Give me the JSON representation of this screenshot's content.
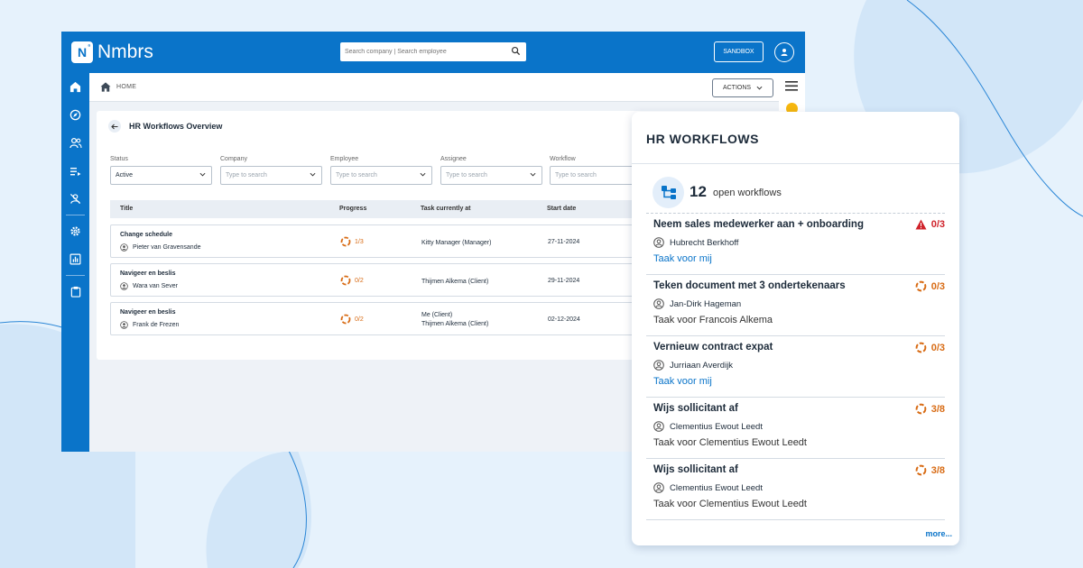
{
  "app": {
    "logo_mark": "N",
    "logo_sup": "ª",
    "name": "Nmbrs"
  },
  "topbar": {
    "search_placeholder": "Search company | Search employee",
    "sandbox_label": "SANDBOX"
  },
  "subbar": {
    "breadcrumb": "HOME",
    "actions_label": "ACTIONS"
  },
  "card": {
    "title": "HR Workflows Overview"
  },
  "filters": [
    {
      "label": "Status",
      "value": "Active"
    },
    {
      "label": "Company",
      "value": "Type to search"
    },
    {
      "label": "Employee",
      "value": "Type to search"
    },
    {
      "label": "Assignee",
      "value": "Type to search"
    },
    {
      "label": "Workflow",
      "value": "Type to search"
    }
  ],
  "table": {
    "headers": [
      "Title",
      "Progress",
      "Task currently at",
      "Start date"
    ],
    "rows": [
      {
        "title": "Change schedule",
        "person": "Pieter van Gravensande",
        "progress": "1/3",
        "task1": "Kitty Manager (Manager)",
        "task2": "",
        "date": "27-11-2024"
      },
      {
        "title": "Navigeer en beslis",
        "person": "Wara van Sever",
        "progress": "0/2",
        "task1": "Thijmen Alkema (Client)",
        "task2": "",
        "date": "29-11-2024"
      },
      {
        "title": "Navigeer en beslis",
        "person": "Frank de Frezen",
        "progress": "0/2",
        "task1": "Me (Client)",
        "task2": "Thijmen Alkema (Client)",
        "date": "02-12-2024"
      }
    ]
  },
  "panel": {
    "title": "HR WORKFLOWS",
    "open_count": "12",
    "open_label": "open workflows",
    "more_label": "more...",
    "items": [
      {
        "name": "Neem sales medewerker aan + onboarding",
        "person": "Hubrecht Berkhoff",
        "assignment": "Taak voor mij",
        "status": "0/3",
        "kind": "warning"
      },
      {
        "name": "Teken document met 3 ondertekenaars",
        "person": "Jan-Dirk Hageman",
        "assignment": "Taak voor Francois Alkema",
        "status": "0/3",
        "kind": "progress"
      },
      {
        "name": "Vernieuw contract expat",
        "person": "Jurriaan Averdijk",
        "assignment": "Taak voor mij",
        "status": "0/3",
        "kind": "progress"
      },
      {
        "name": "Wijs sollicitant af",
        "person": "Clementius Ewout Leedt",
        "assignment": "Taak voor Clementius Ewout Leedt",
        "status": "3/8",
        "kind": "progress"
      },
      {
        "name": "Wijs sollicitant af",
        "person": "Clementius Ewout Leedt",
        "assignment": "Taak voor Clementius Ewout Leedt",
        "status": "3/8",
        "kind": "progress"
      }
    ]
  },
  "colors": {
    "brand": "#0a74c9",
    "progress": "#d86b14",
    "warning": "#d0232b",
    "background": "#e6f2fc"
  }
}
